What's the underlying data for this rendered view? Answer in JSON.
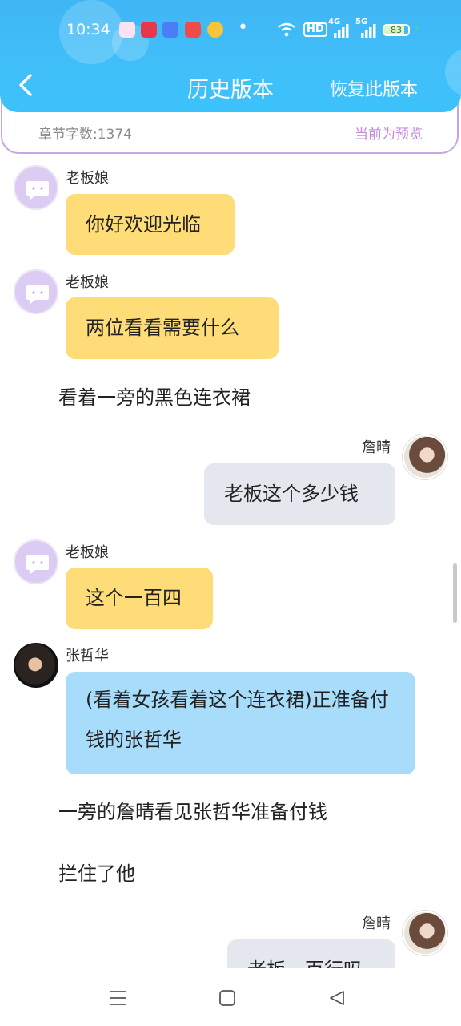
{
  "status_bar": {
    "time": "10:34",
    "app_icons": [
      "app-icon-1",
      "app-icon-2",
      "app-icon-3",
      "app-icon-4",
      "weibo-icon"
    ],
    "network": [
      "wifi-icon",
      "HD",
      "4G",
      "5G"
    ],
    "battery": "83"
  },
  "header": {
    "back_icon": "chevron-left-icon",
    "title": "历史版本",
    "restore_label": "恢复此版本"
  },
  "info": {
    "word_count": "章节字数:1374",
    "preview_note": "当前为预览"
  },
  "chat": {
    "m1": {
      "sender": "老板娘",
      "text": "你好欢迎光临"
    },
    "m2": {
      "sender": "老板娘",
      "text": "两位看看需要什么"
    },
    "n1": "看着一旁的黑色连衣裙",
    "m3": {
      "sender": "詹晴",
      "text": "老板这个多少钱"
    },
    "m4": {
      "sender": "老板娘",
      "text": "这个一百四"
    },
    "m5": {
      "sender": "张哲华",
      "text": "(看着女孩看着这个连衣裙)正准备付钱的张哲华"
    },
    "n2": "一旁的詹晴看见张哲华准备付钱",
    "n3": "拦住了他",
    "m6": {
      "sender": "詹晴",
      "text": "老板一百行吗"
    }
  },
  "system_nav": [
    "menu-icon",
    "home-icon",
    "back-triangle-icon"
  ],
  "colors": {
    "header": "#3fb6f5",
    "bubble_yellow": "#fedc77",
    "bubble_gray": "#e4e8ee",
    "bubble_blue": "#a7dcfa",
    "accent_purple": "#c58bd8"
  }
}
